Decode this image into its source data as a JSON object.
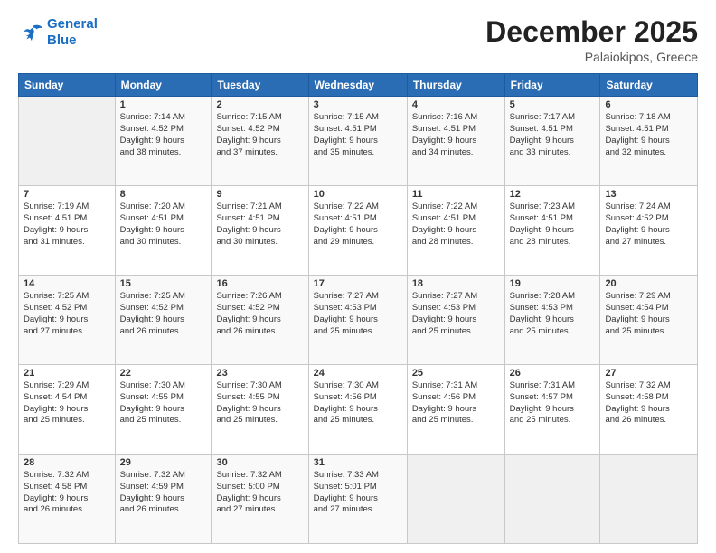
{
  "header": {
    "logo_line1": "General",
    "logo_line2": "Blue",
    "month": "December 2025",
    "location": "Palaiokipos, Greece"
  },
  "days_of_week": [
    "Sunday",
    "Monday",
    "Tuesday",
    "Wednesday",
    "Thursday",
    "Friday",
    "Saturday"
  ],
  "weeks": [
    [
      {
        "day": "",
        "content": ""
      },
      {
        "day": "1",
        "content": "Sunrise: 7:14 AM\nSunset: 4:52 PM\nDaylight: 9 hours\nand 38 minutes."
      },
      {
        "day": "2",
        "content": "Sunrise: 7:15 AM\nSunset: 4:52 PM\nDaylight: 9 hours\nand 37 minutes."
      },
      {
        "day": "3",
        "content": "Sunrise: 7:15 AM\nSunset: 4:51 PM\nDaylight: 9 hours\nand 35 minutes."
      },
      {
        "day": "4",
        "content": "Sunrise: 7:16 AM\nSunset: 4:51 PM\nDaylight: 9 hours\nand 34 minutes."
      },
      {
        "day": "5",
        "content": "Sunrise: 7:17 AM\nSunset: 4:51 PM\nDaylight: 9 hours\nand 33 minutes."
      },
      {
        "day": "6",
        "content": "Sunrise: 7:18 AM\nSunset: 4:51 PM\nDaylight: 9 hours\nand 32 minutes."
      }
    ],
    [
      {
        "day": "7",
        "content": "Sunrise: 7:19 AM\nSunset: 4:51 PM\nDaylight: 9 hours\nand 31 minutes."
      },
      {
        "day": "8",
        "content": "Sunrise: 7:20 AM\nSunset: 4:51 PM\nDaylight: 9 hours\nand 30 minutes."
      },
      {
        "day": "9",
        "content": "Sunrise: 7:21 AM\nSunset: 4:51 PM\nDaylight: 9 hours\nand 30 minutes."
      },
      {
        "day": "10",
        "content": "Sunrise: 7:22 AM\nSunset: 4:51 PM\nDaylight: 9 hours\nand 29 minutes."
      },
      {
        "day": "11",
        "content": "Sunrise: 7:22 AM\nSunset: 4:51 PM\nDaylight: 9 hours\nand 28 minutes."
      },
      {
        "day": "12",
        "content": "Sunrise: 7:23 AM\nSunset: 4:51 PM\nDaylight: 9 hours\nand 28 minutes."
      },
      {
        "day": "13",
        "content": "Sunrise: 7:24 AM\nSunset: 4:52 PM\nDaylight: 9 hours\nand 27 minutes."
      }
    ],
    [
      {
        "day": "14",
        "content": "Sunrise: 7:25 AM\nSunset: 4:52 PM\nDaylight: 9 hours\nand 27 minutes."
      },
      {
        "day": "15",
        "content": "Sunrise: 7:25 AM\nSunset: 4:52 PM\nDaylight: 9 hours\nand 26 minutes."
      },
      {
        "day": "16",
        "content": "Sunrise: 7:26 AM\nSunset: 4:52 PM\nDaylight: 9 hours\nand 26 minutes."
      },
      {
        "day": "17",
        "content": "Sunrise: 7:27 AM\nSunset: 4:53 PM\nDaylight: 9 hours\nand 25 minutes."
      },
      {
        "day": "18",
        "content": "Sunrise: 7:27 AM\nSunset: 4:53 PM\nDaylight: 9 hours\nand 25 minutes."
      },
      {
        "day": "19",
        "content": "Sunrise: 7:28 AM\nSunset: 4:53 PM\nDaylight: 9 hours\nand 25 minutes."
      },
      {
        "day": "20",
        "content": "Sunrise: 7:29 AM\nSunset: 4:54 PM\nDaylight: 9 hours\nand 25 minutes."
      }
    ],
    [
      {
        "day": "21",
        "content": "Sunrise: 7:29 AM\nSunset: 4:54 PM\nDaylight: 9 hours\nand 25 minutes."
      },
      {
        "day": "22",
        "content": "Sunrise: 7:30 AM\nSunset: 4:55 PM\nDaylight: 9 hours\nand 25 minutes."
      },
      {
        "day": "23",
        "content": "Sunrise: 7:30 AM\nSunset: 4:55 PM\nDaylight: 9 hours\nand 25 minutes."
      },
      {
        "day": "24",
        "content": "Sunrise: 7:30 AM\nSunset: 4:56 PM\nDaylight: 9 hours\nand 25 minutes."
      },
      {
        "day": "25",
        "content": "Sunrise: 7:31 AM\nSunset: 4:56 PM\nDaylight: 9 hours\nand 25 minutes."
      },
      {
        "day": "26",
        "content": "Sunrise: 7:31 AM\nSunset: 4:57 PM\nDaylight: 9 hours\nand 25 minutes."
      },
      {
        "day": "27",
        "content": "Sunrise: 7:32 AM\nSunset: 4:58 PM\nDaylight: 9 hours\nand 26 minutes."
      }
    ],
    [
      {
        "day": "28",
        "content": "Sunrise: 7:32 AM\nSunset: 4:58 PM\nDaylight: 9 hours\nand 26 minutes."
      },
      {
        "day": "29",
        "content": "Sunrise: 7:32 AM\nSunset: 4:59 PM\nDaylight: 9 hours\nand 26 minutes."
      },
      {
        "day": "30",
        "content": "Sunrise: 7:32 AM\nSunset: 5:00 PM\nDaylight: 9 hours\nand 27 minutes."
      },
      {
        "day": "31",
        "content": "Sunrise: 7:33 AM\nSunset: 5:01 PM\nDaylight: 9 hours\nand 27 minutes."
      },
      {
        "day": "",
        "content": ""
      },
      {
        "day": "",
        "content": ""
      },
      {
        "day": "",
        "content": ""
      }
    ]
  ]
}
